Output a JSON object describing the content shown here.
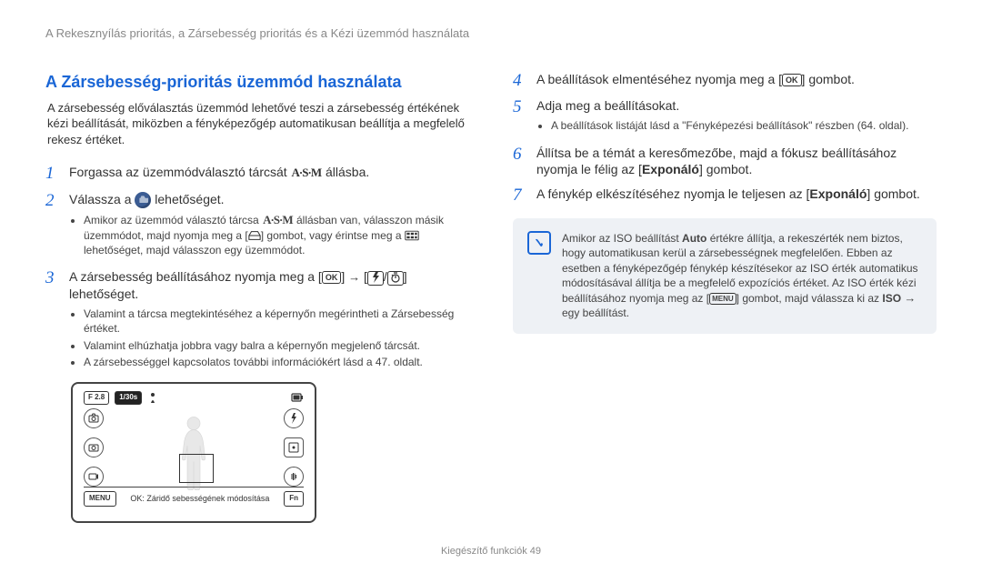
{
  "breadcrumb": "A Rekesznyílás prioritás, a Zársebesség prioritás és a Kézi üzemmód használata",
  "left": {
    "heading": "A Zársebesség-prioritás üzemmód használata",
    "intro": "A zársebesség előválasztás üzemmód lehetővé teszi a zársebesség értékének kézi beállítását, miközben a fényképezőgép automatikusan beállítja a megfelelő rekesz értéket.",
    "step1": {
      "num": "1",
      "pre": "Forgassa az üzemmódválasztó tárcsát ",
      "asm": "A·S·M",
      "post": " állásba."
    },
    "step2": {
      "num": "2",
      "pre": "Válassza a ",
      "post": " lehetőséget.",
      "bullet_pre": "Amikor az üzemmód választó tárcsa ",
      "bullet_asm": "A·S·M",
      "bullet_mid": " állásban van, válasszon másik üzemmódot, majd nyomja meg a [",
      "bullet_mid2": "] gombot, vagy érintse meg a ",
      "bullet_post": " lehetőséget, majd válasszon egy üzemmódot."
    },
    "step3": {
      "num": "3",
      "pre": "A zársebesség beállításához nyomja meg a [",
      "ok": "OK",
      "post": "] lehetőséget.",
      "bullets": [
        "Valamint a tárcsa megtekintéséhez a képernyőn megérintheti a Zársebesség értéket.",
        "Valamint elhúzhatja jobbra vagy balra a képernyőn megjelenő tárcsát.",
        "A zársebességgel kapcsolatos további információkért lásd a 47. oldalt."
      ]
    },
    "figure": {
      "f": "F 2.8",
      "shutter": "1/30s",
      "menu": "MENU",
      "fn": "Fn",
      "bottom_text": "OK: Záridő sebességének módosítása"
    }
  },
  "right": {
    "step4": {
      "num": "4",
      "pre": "A beállítások elmentéséhez nyomja meg a [",
      "ok": "OK",
      "post": "] gombot."
    },
    "step5": {
      "num": "5",
      "title": "Adja meg a beállításokat.",
      "bullet": "A beállítások listáját lásd a \"Fényképezési beállítások\" részben (64. oldal)."
    },
    "step6": {
      "num": "6",
      "text_pre": "Állítsa be a témát a keresőmezőbe, majd a fókusz beállításához nyomja le félig az [",
      "bold": "Exponáló",
      "text_post": "] gombot."
    },
    "step7": {
      "num": "7",
      "text_pre": "A fénykép elkészítéséhez nyomja le teljesen az [",
      "bold": "Exponáló",
      "text_post": "] gombot."
    },
    "note": {
      "pre": "Amikor az ISO beállítást ",
      "auto": "Auto",
      "mid": " értékre állítja, a rekeszérték nem biztos, hogy automatikusan kerül a zársebességnek megfelelően. Ebben az esetben a fényképezőgép fénykép készítésekor az ISO érték automatikus módosításával állítja be a megfelelő expozíciós értéket. Az ISO érték kézi beállításához nyomja meg az [",
      "menu": "MENU",
      "mid2": "] gombot, majd válassza ki az ",
      "iso": "ISO",
      "post": " egy beállítást."
    }
  },
  "footer": "Kiegészítő funkciók  49"
}
